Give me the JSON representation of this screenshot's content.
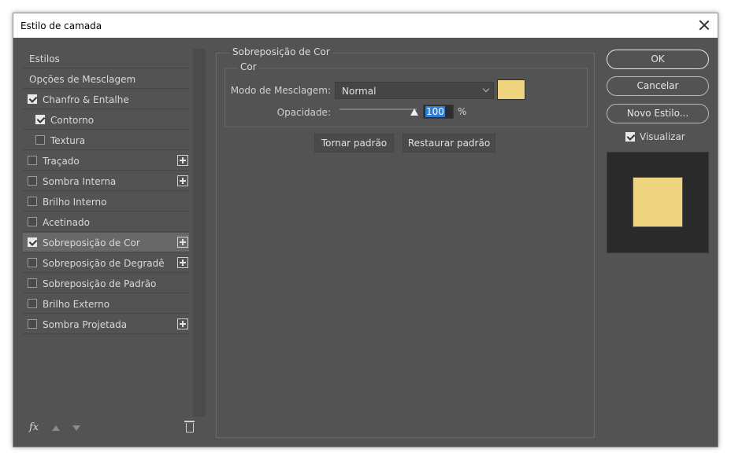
{
  "window": {
    "title": "Estilo de camada"
  },
  "sidebar": {
    "items": [
      {
        "label": "Estilos",
        "checkbox": false,
        "checked": false,
        "indent": false,
        "plus": false,
        "selected": false
      },
      {
        "label": "Opções de Mesclagem",
        "checkbox": false,
        "checked": false,
        "indent": false,
        "plus": false,
        "selected": false
      },
      {
        "label": "Chanfro & Entalhe",
        "checkbox": true,
        "checked": true,
        "indent": false,
        "plus": false,
        "selected": false
      },
      {
        "label": "Contorno",
        "checkbox": true,
        "checked": true,
        "indent": true,
        "plus": false,
        "selected": false
      },
      {
        "label": "Textura",
        "checkbox": true,
        "checked": false,
        "indent": true,
        "plus": false,
        "selected": false
      },
      {
        "label": "Traçado",
        "checkbox": true,
        "checked": false,
        "indent": false,
        "plus": true,
        "selected": false
      },
      {
        "label": "Sombra Interna",
        "checkbox": true,
        "checked": false,
        "indent": false,
        "plus": true,
        "selected": false
      },
      {
        "label": "Brilho Interno",
        "checkbox": true,
        "checked": false,
        "indent": false,
        "plus": false,
        "selected": false
      },
      {
        "label": "Acetinado",
        "checkbox": true,
        "checked": false,
        "indent": false,
        "plus": false,
        "selected": false
      },
      {
        "label": "Sobreposição de Cor",
        "checkbox": true,
        "checked": true,
        "indent": false,
        "plus": true,
        "selected": true
      },
      {
        "label": "Sobreposição de Degradê",
        "checkbox": true,
        "checked": false,
        "indent": false,
        "plus": true,
        "selected": false
      },
      {
        "label": "Sobreposição de Padrão",
        "checkbox": true,
        "checked": false,
        "indent": false,
        "plus": false,
        "selected": false
      },
      {
        "label": "Brilho Externo",
        "checkbox": true,
        "checked": false,
        "indent": false,
        "plus": false,
        "selected": false
      },
      {
        "label": "Sombra Projetada",
        "checkbox": true,
        "checked": false,
        "indent": false,
        "plus": true,
        "selected": false
      }
    ],
    "bottom": {
      "fx_label": "fx"
    }
  },
  "main": {
    "section_title": "Sobreposição de Cor",
    "group_title": "Cor",
    "blend_mode_label": "Modo de Mesclagem:",
    "blend_mode_value": "Normal",
    "overlay_color": "#eed47e",
    "opacity_label": "Opacidade:",
    "opacity_value": "100",
    "opacity_unit": "%",
    "make_default_label": "Tornar padrão",
    "reset_default_label": "Restaurar padrão"
  },
  "actions": {
    "ok_label": "OK",
    "cancel_label": "Cancelar",
    "new_style_label": "Novo Estilo...",
    "preview_label": "Visualizar",
    "preview_checked": true
  },
  "preview": {
    "swatch_color": "#eed47e"
  }
}
